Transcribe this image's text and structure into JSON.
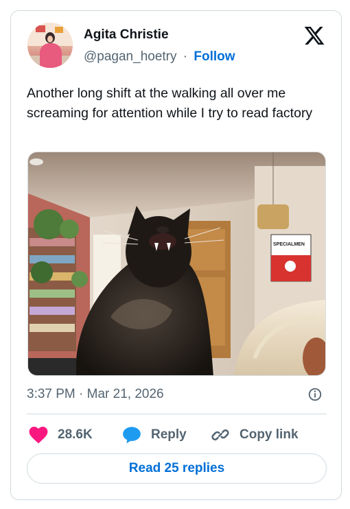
{
  "author": {
    "name": "Agita Christie",
    "handle": "@pagan_hoetry",
    "separator": "·",
    "follow_label": "Follow"
  },
  "brand": {
    "logo_icon": "x-logo-icon"
  },
  "tweet": {
    "text": "Another long shift at the walking all over me screaming for attention while I try to read factory",
    "media": {
      "poster_text": "SPECIALMEN"
    },
    "timestamp": "3:37 PM · Mar 21, 2026"
  },
  "actions": {
    "like_count": "28.6K",
    "reply_label": "Reply",
    "copy_link_label": "Copy link",
    "read_replies_label": "Read 25 replies"
  },
  "colors": {
    "like": "#f91880",
    "reply": "#1d9bf0",
    "link": "#006fd6",
    "secondary_text": "#536471",
    "border": "#cfd9de"
  }
}
